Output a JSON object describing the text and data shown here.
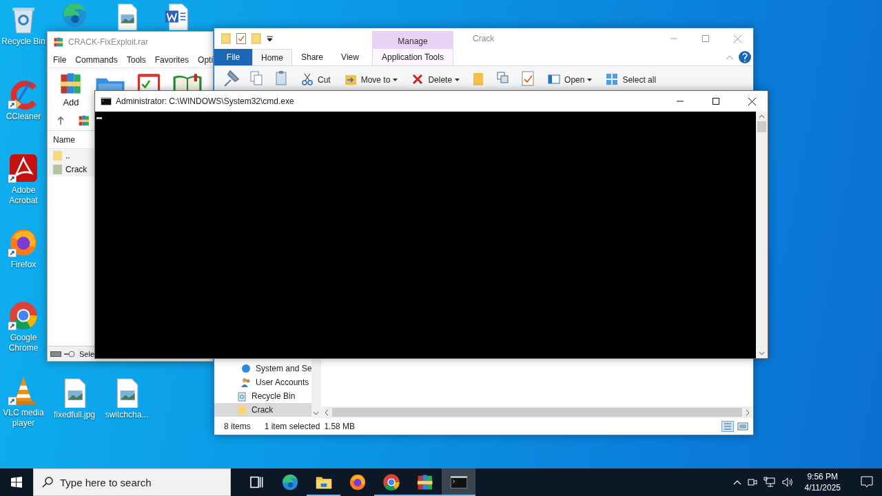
{
  "desktop_icons": [
    {
      "kind": "recycle-bin",
      "label": "Recycle Bin",
      "shortcut": false
    },
    {
      "kind": "edge",
      "shortcut": false
    },
    {
      "kind": "image-file",
      "shortcut": false
    },
    {
      "kind": "word-file",
      "shortcut": false
    },
    {
      "kind": "ccleaner",
      "label": "CCleaner",
      "shortcut": true
    },
    {
      "kind": "acrobat",
      "label": "Adobe Acrobat",
      "shortcut": true
    },
    {
      "kind": "firefox",
      "label": "Firefox",
      "shortcut": true
    },
    {
      "kind": "chrome",
      "label": "Google Chrome",
      "shortcut": true
    },
    {
      "kind": "vlc",
      "label": "VLC media player",
      "shortcut": true
    },
    {
      "kind": "image-file",
      "label": "fixedfull.jpg",
      "shortcut": false
    },
    {
      "kind": "image-file",
      "label": "switchcha...",
      "shortcut": false
    }
  ],
  "archiver": {
    "title": "CRACK-FixExploit.rar",
    "menu": [
      "File",
      "Commands",
      "Tools",
      "Favorites",
      "Opti"
    ],
    "toolbar": [
      {
        "kind": "add",
        "label": "Add"
      },
      {
        "kind": "extract"
      },
      {
        "kind": "test"
      },
      {
        "kind": "view"
      }
    ],
    "columns": [
      "Name"
    ],
    "rows": [
      {
        "name": "..",
        "kind": "parent"
      },
      {
        "name": "Crack",
        "kind": "folder"
      }
    ],
    "status": "Sele"
  },
  "explorer": {
    "title": "Crack",
    "context_group": "Manage",
    "tabs": [
      {
        "label": "File",
        "kind": "file",
        "selected": false
      },
      {
        "label": "Home",
        "kind": "tab",
        "selected": true
      },
      {
        "label": "Share",
        "kind": "tab",
        "selected": false
      },
      {
        "label": "View",
        "kind": "tab",
        "selected": false
      },
      {
        "label": "Application Tools",
        "kind": "context",
        "selected": false
      }
    ],
    "ribbon": [
      {
        "kind": "pin"
      },
      {
        "kind": "copy"
      },
      {
        "kind": "paste"
      },
      {
        "kind": "cut",
        "label": "Cut",
        "dropdown": false
      },
      {
        "kind": "move",
        "label": "Move to",
        "dropdown": true
      },
      {
        "kind": "delete",
        "label": "Delete",
        "dropdown": true
      },
      {
        "kind": "new-folder"
      },
      {
        "kind": "copy-to"
      },
      {
        "kind": "properties"
      },
      {
        "kind": "open",
        "label": "Open",
        "dropdown": true
      },
      {
        "kind": "select-all",
        "label": "Select all",
        "dropdown": false
      }
    ],
    "nav_sub_items": [
      {
        "label": "System and Se",
        "kind": "system",
        "selected": false
      },
      {
        "label": "User Accounts",
        "kind": "users",
        "selected": false
      }
    ],
    "nav_items": [
      {
        "label": "Recycle Bin",
        "kind": "recycle",
        "selected": false
      },
      {
        "label": "Crack",
        "kind": "folder",
        "selected": true
      }
    ],
    "status": {
      "count": "8 items",
      "selection": "1 item selected",
      "size": "1.58 MB"
    }
  },
  "console": {
    "title": "Administrator: C:\\WINDOWS\\System32\\cmd.exe"
  },
  "taskbar": {
    "search": {
      "placeholder": "Type here to search"
    },
    "apps": [
      {
        "kind": "task-view",
        "running": false,
        "selected": false
      },
      {
        "kind": "edge",
        "running": false,
        "selected": false
      },
      {
        "kind": "explorer",
        "running": true,
        "selected": false
      },
      {
        "kind": "firefox",
        "running": false,
        "selected": false
      },
      {
        "kind": "chrome",
        "running": true,
        "selected": false
      },
      {
        "kind": "winrar",
        "running": true,
        "selected": false
      },
      {
        "kind": "console",
        "running": true,
        "selected": true
      }
    ],
    "time": "9:56 PM",
    "date": "4/11/2025"
  }
}
